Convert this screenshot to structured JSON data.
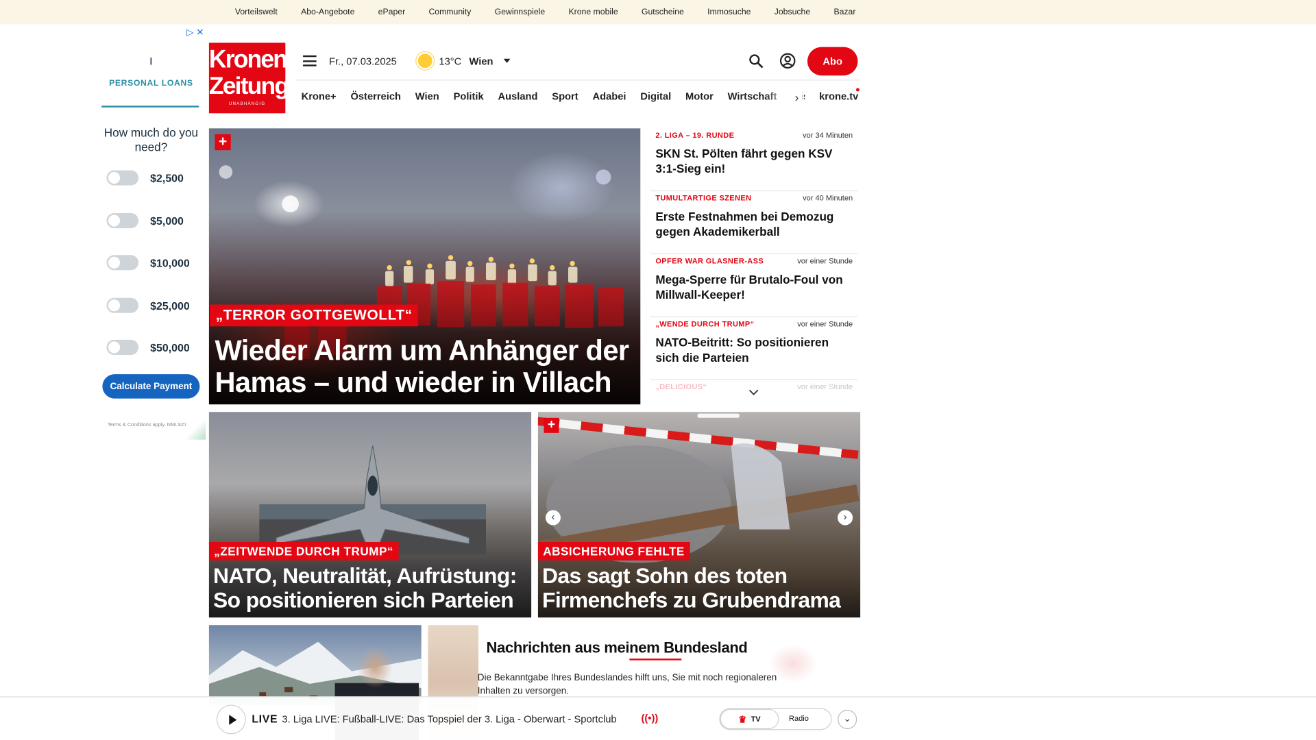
{
  "topbar": {
    "links": [
      "Vorteilswelt",
      "Abo-Angebote",
      "ePaper",
      "Community",
      "Gewinnspiele",
      "Krone mobile",
      "Gutscheine",
      "Immosuche",
      "Jobsuche",
      "Bazar"
    ]
  },
  "ad": {
    "choices_icon": "adchoices-icon",
    "logo_glyph": "ı",
    "brand_label": "PERSONAL LOANS",
    "question": "How much do you need?",
    "options": [
      "$2,500",
      "$5,000",
      "$10,000",
      "$25,000",
      "$50,000"
    ],
    "cta": "Calculate Payment",
    "terms": "Terms & Conditions apply. NMLS#1136"
  },
  "brand": {
    "line1": "Kronen",
    "line2": "Zeitung",
    "tagline": "UNABHÄNGIG",
    "color": "#e30613"
  },
  "header": {
    "date": "Fr., 07.03.2025",
    "temperature": "13°C",
    "city": "Wien",
    "abo_label": "Abo"
  },
  "nav": {
    "items": [
      "Krone+",
      "Österreich",
      "Wien",
      "Politik",
      "Ausland",
      "Sport",
      "Adabei",
      "Digital",
      "Motor",
      "Wirtschaft",
      "Wiss"
    ],
    "tv_link": "krone.tv"
  },
  "hero": {
    "kicker": "„TERROR GOTTGEWOLLT“",
    "title": "Wieder Alarm um Anhänger der Hamas – und wieder in Villach"
  },
  "news": [
    {
      "kicker": "2. LIGA – 19. RUNDE",
      "time": "vor 34 Minuten",
      "headline": "SKN St. Pölten fährt gegen KSV 3:1-Sieg ein!"
    },
    {
      "kicker": "TUMULTARTIGE SZENEN",
      "time": "vor 40 Minuten",
      "headline": "Erste Festnahmen bei Demozug gegen Akademikerball"
    },
    {
      "kicker": "OPFER WAR GLASNER-ASS",
      "time": "vor einer Stunde",
      "headline": "Mega-Sperre für Brutalo-Foul von Millwall-Keeper!"
    },
    {
      "kicker": "„WENDE DURCH TRUMP“",
      "time": "vor einer Stunde",
      "headline": "NATO-Beitritt: So positionieren sich die Parteien"
    },
    {
      "kicker": "„DELICIOUS“",
      "time": "vor einer Stunde",
      "headline": ""
    }
  ],
  "cards": [
    {
      "kicker": "„ZEITWENDE DURCH TRUMP“",
      "title": "NATO, Neutralität, Aufrüstung: So positionieren sich Parteien"
    },
    {
      "kicker": "ABSICHERUNG FEHLTE",
      "title": "Das sagt Sohn des toten Firmenchefs zu Grubendrama"
    }
  ],
  "bundesland": {
    "heading": "Nachrichten aus meinem Bundesland",
    "text": "Die Bekanntgabe Ihres Bundeslandes hilft uns, Sie mit noch regionaleren Inhalten zu versorgen."
  },
  "livebar": {
    "live_label": "LIVE",
    "text": "3. Liga LIVE: Fußball-LIVE: Das Topspiel der 3. Liga - Oberwart - Sportclub",
    "tv_label": "TV",
    "radio_label": "Radio"
  }
}
